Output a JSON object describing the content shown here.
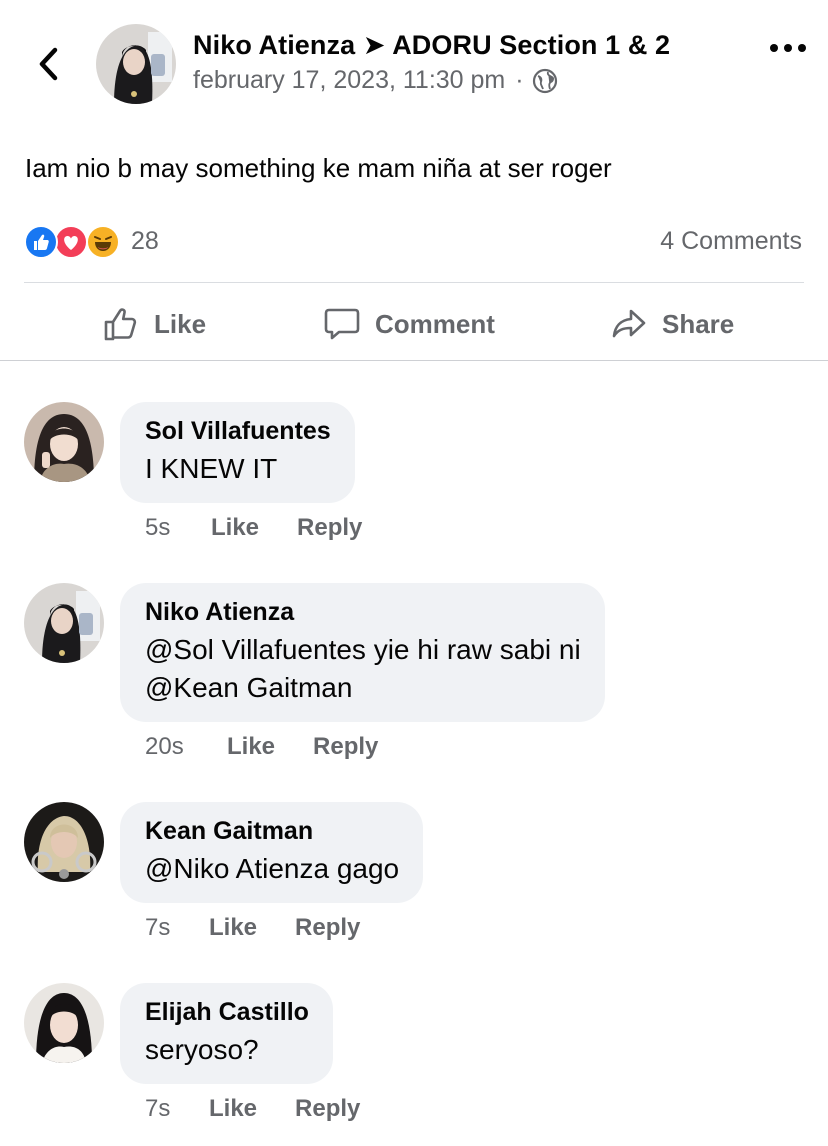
{
  "post": {
    "author": "Niko Atienza",
    "arrow": "➤",
    "group": "ADORU Section 1 & 2",
    "date": "february 17, 2023, 11:30 pm",
    "separator": "·",
    "privacy_icon": "globe-icon",
    "text": "Iam nio b may something ke mam niña at ser roger"
  },
  "reactions": {
    "types": [
      "like",
      "love",
      "haha"
    ],
    "count": "28",
    "comments_label": "4 Comments"
  },
  "actions": {
    "like": "Like",
    "comment": "Comment",
    "share": "Share"
  },
  "comments": [
    {
      "name": "Sol Villafuentes",
      "text": [
        "I KNEW IT"
      ],
      "time": "5s",
      "like": "Like",
      "reply": "Reply"
    },
    {
      "name": "Niko Atienza",
      "text": [
        "@Sol Villafuentes yie hi raw sabi ni",
        "@Kean Gaitman"
      ],
      "time": "20s",
      "like": "Like",
      "reply": "Reply"
    },
    {
      "name": "Kean Gaitman",
      "text": [
        "@Niko Atienza gago"
      ],
      "time": "7s",
      "like": "Like",
      "reply": "Reply"
    },
    {
      "name": "Elijah Castillo",
      "text": [
        "seryoso?"
      ],
      "time": "7s",
      "like": "Like",
      "reply": "Reply"
    }
  ],
  "colors": {
    "like_blue": "#1877f2",
    "love_red": "#f33e58",
    "haha_yellow": "#f7b125",
    "secondary_text": "#65676b",
    "bubble_bg": "#f0f2f5"
  }
}
